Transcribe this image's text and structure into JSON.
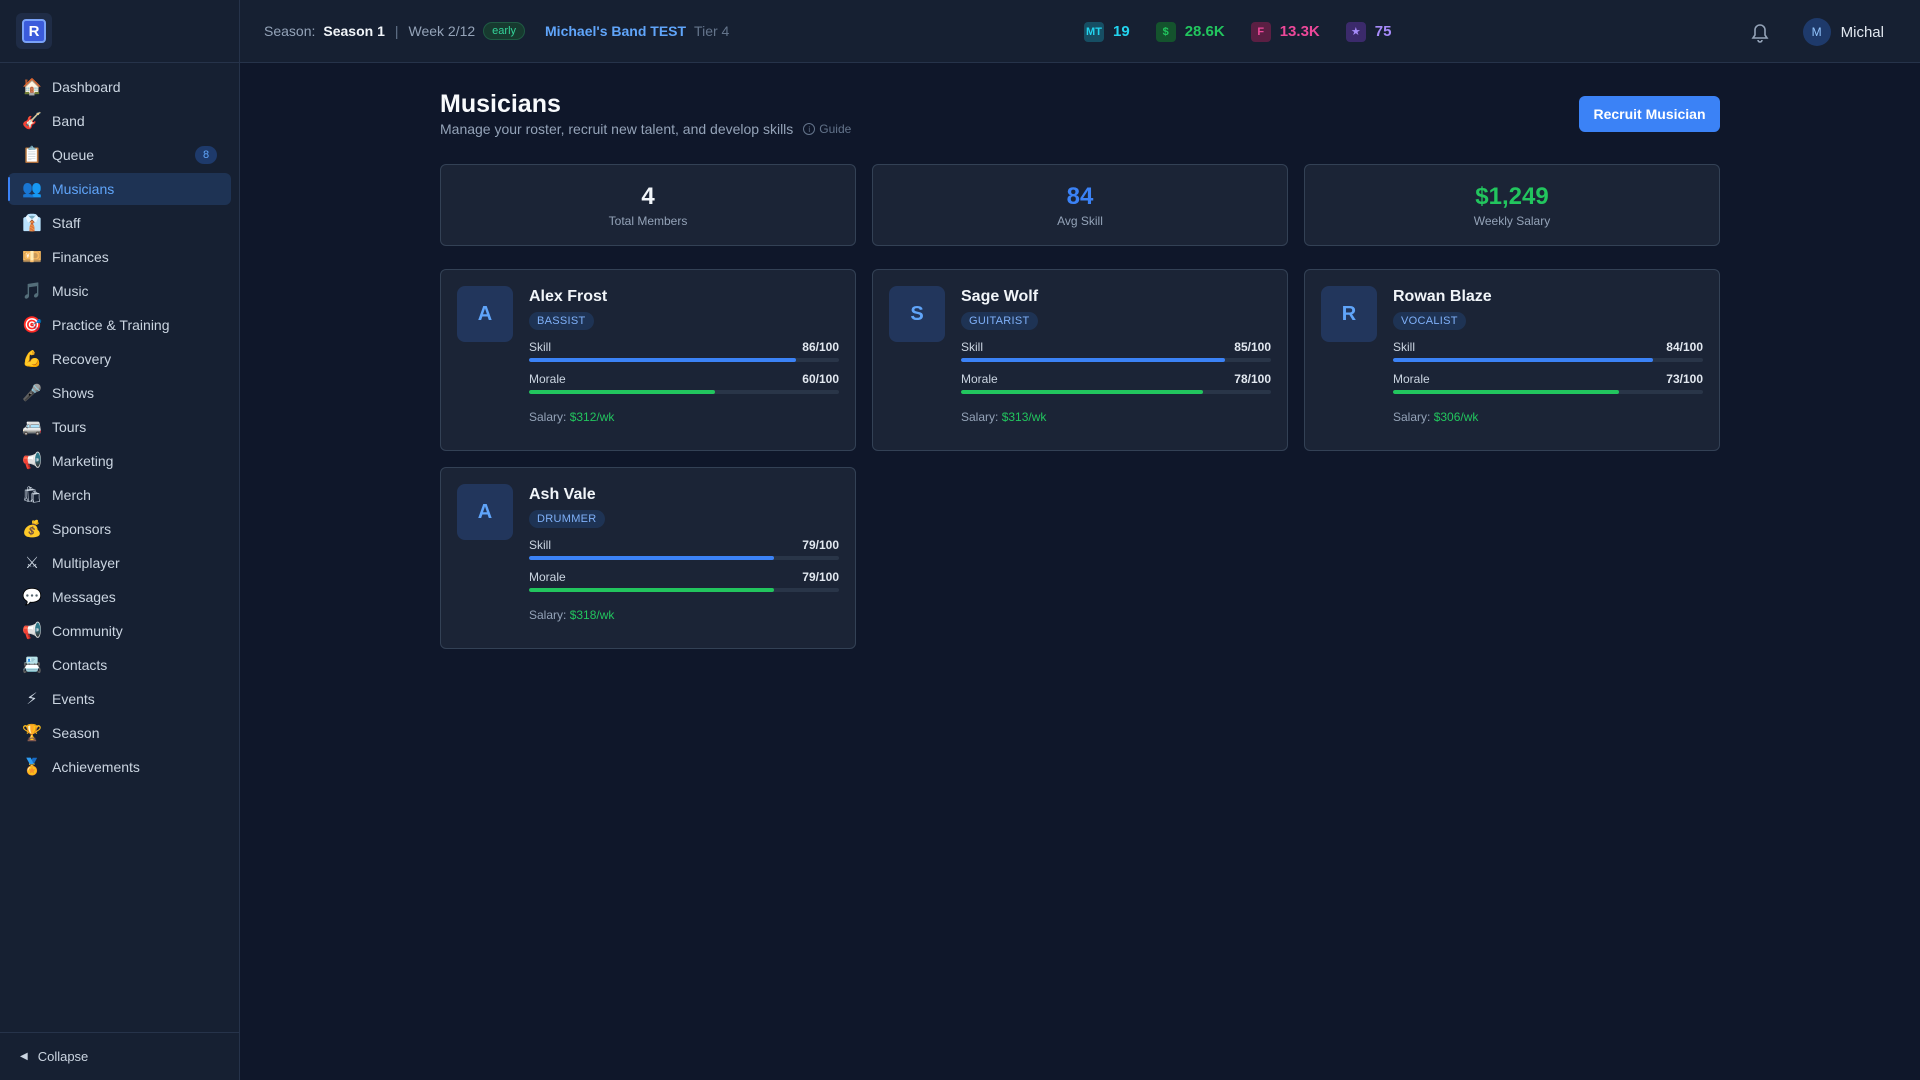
{
  "sidebar": {
    "logo_letter": "R",
    "items": [
      {
        "icon": "🏠",
        "label": "Dashboard"
      },
      {
        "icon": "🎸",
        "label": "Band"
      },
      {
        "icon": "📋",
        "label": "Queue",
        "badge": "8"
      },
      {
        "icon": "👥",
        "label": "Musicians",
        "active": true
      },
      {
        "icon": "👔",
        "label": "Staff"
      },
      {
        "icon": "💴",
        "label": "Finances"
      },
      {
        "icon": "🎵",
        "label": "Music"
      },
      {
        "icon": "🎯",
        "label": "Practice & Training"
      },
      {
        "icon": "💪",
        "label": "Recovery"
      },
      {
        "icon": "🎤",
        "label": "Shows"
      },
      {
        "icon": "🚐",
        "label": "Tours"
      },
      {
        "icon": "📢",
        "label": "Marketing"
      },
      {
        "icon": "🛍",
        "label": "Merch"
      },
      {
        "icon": "💰",
        "label": "Sponsors"
      },
      {
        "icon": "⚔",
        "label": "Multiplayer"
      },
      {
        "icon": "💬",
        "label": "Messages"
      },
      {
        "icon": "📢",
        "label": "Community"
      },
      {
        "icon": "📇",
        "label": "Contacts"
      },
      {
        "icon": "⚡",
        "label": "Events"
      },
      {
        "icon": "🏆",
        "label": "Season"
      },
      {
        "icon": "🏅",
        "label": "Achievements"
      }
    ],
    "collapse_label": "Collapse",
    "collapse_icon": "◀"
  },
  "topbar": {
    "season_label": "Season:",
    "season_value": "Season 1",
    "week": "Week 2/12",
    "phase_badge": "early",
    "band_name": "Michael's Band TEST",
    "tier": "Tier 4",
    "stats": [
      {
        "name": "mt",
        "chip": "MT",
        "value": "19",
        "color": "#22d3ee",
        "chip_bg": "#164e63"
      },
      {
        "name": "money",
        "chip": "$",
        "value": "28.6K",
        "color": "#22c55e",
        "chip_bg": "#14532d"
      },
      {
        "name": "fans",
        "chip": "F",
        "value": "13.3K",
        "color": "#ec4899",
        "chip_bg": "#5b1f43"
      },
      {
        "name": "fame",
        "chip": "★",
        "value": "75",
        "color": "#a78bfa",
        "chip_bg": "#3b2a6b"
      }
    ],
    "user_initial": "M",
    "user_name": "Michal"
  },
  "page": {
    "title": "Musicians",
    "subtitle": "Manage your roster, recruit new talent, and develop skills",
    "guide_label": "Guide",
    "recruit_label": "Recruit Musician"
  },
  "summary": [
    {
      "value": "4",
      "label": "Total Members",
      "color": "#f1f5f9"
    },
    {
      "value": "84",
      "label": "Avg Skill",
      "color": "#3b82f6"
    },
    {
      "value": "$1,249",
      "label": "Weekly Salary",
      "color": "#22c55e"
    }
  ],
  "musicians": [
    {
      "initial": "A",
      "name": "Alex Frost",
      "role": "BASSIST",
      "skill_label": "Skill",
      "skill_text": "86/100",
      "skill": 86,
      "morale_label": "Morale",
      "morale_text": "60/100",
      "morale": 60,
      "salary_label": "Salary:",
      "salary": "$312/wk"
    },
    {
      "initial": "S",
      "name": "Sage Wolf",
      "role": "GUITARIST",
      "skill_label": "Skill",
      "skill_text": "85/100",
      "skill": 85,
      "morale_label": "Morale",
      "morale_text": "78/100",
      "morale": 78,
      "salary_label": "Salary:",
      "salary": "$313/wk"
    },
    {
      "initial": "R",
      "name": "Rowan Blaze",
      "role": "VOCALIST",
      "skill_label": "Skill",
      "skill_text": "84/100",
      "skill": 84,
      "morale_label": "Morale",
      "morale_text": "73/100",
      "morale": 73,
      "salary_label": "Salary:",
      "salary": "$306/wk"
    },
    {
      "initial": "A",
      "name": "Ash Vale",
      "role": "DRUMMER",
      "skill_label": "Skill",
      "skill_text": "79/100",
      "skill": 79,
      "morale_label": "Morale",
      "morale_text": "79/100",
      "morale": 79,
      "salary_label": "Salary:",
      "salary": "$318/wk"
    }
  ]
}
